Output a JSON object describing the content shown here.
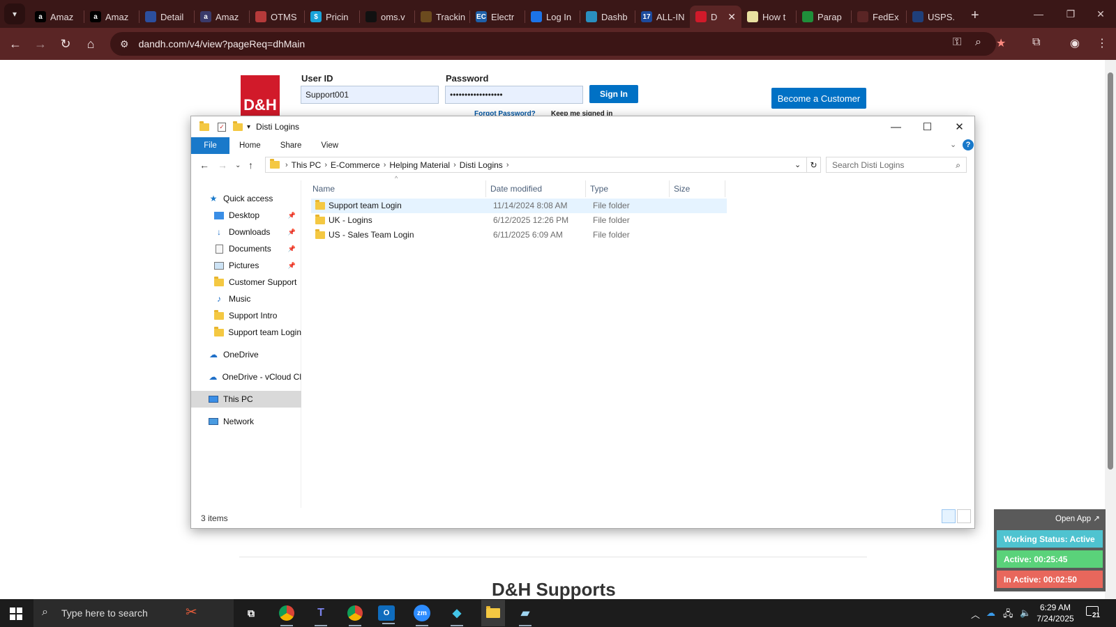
{
  "browser": {
    "tabs": [
      {
        "label": "Amaz",
        "fav": "a",
        "fav_color": "#000000"
      },
      {
        "label": "Amaz",
        "fav": "a",
        "fav_color": "#000000"
      },
      {
        "label": "Detail",
        "fav": "",
        "fav_color": "#2c4f9e"
      },
      {
        "label": "Amaz",
        "fav": "a",
        "fav_color": "#3a3a6a"
      },
      {
        "label": "OTMS",
        "fav": "",
        "fav_color": "#b53a3a"
      },
      {
        "label": "Pricin",
        "fav": "$",
        "fav_color": "#1aa3d9"
      },
      {
        "label": "oms.v",
        "fav": "",
        "fav_color": "#111111"
      },
      {
        "label": "Trackin",
        "fav": "",
        "fav_color": "#6b4a1e"
      },
      {
        "label": "Electr",
        "fav": "EC",
        "fav_color": "#1e5fa8"
      },
      {
        "label": "Log In",
        "fav": "",
        "fav_color": "#1c73e8"
      },
      {
        "label": "Dashb",
        "fav": "",
        "fav_color": "#2a8fbf"
      },
      {
        "label": "ALL-IN",
        "fav": "17",
        "fav_color": "#1d4a9c"
      },
      {
        "label": "D",
        "fav": "",
        "fav_color": "#d11a2a",
        "active": true
      },
      {
        "label": "How t",
        "fav": "",
        "fav_color": "#e8e0a0"
      },
      {
        "label": "Parap",
        "fav": "",
        "fav_color": "#1f8f3a"
      },
      {
        "label": "FedEx",
        "fav": "",
        "fav_color": "#5a2525"
      },
      {
        "label": "USPS.",
        "fav": "",
        "fav_color": "#1f3f7a"
      }
    ],
    "url": "dandh.com/v4/view?pageReq=dhMain"
  },
  "page": {
    "logo_text": "D&H",
    "userid_label": "User ID",
    "userid_value": "Support001",
    "password_label": "Password",
    "password_value": "••••••••••••••••••",
    "signin_label": "Sign In",
    "forgot_label": "Forgot Password?",
    "keep_label": "Keep me signed in",
    "become_label": "Become a Customer",
    "supports_heading": "D&H Supports"
  },
  "explorer": {
    "title": "Disti Logins",
    "ribbon_tabs": [
      "File",
      "Home",
      "Share",
      "View"
    ],
    "breadcrumb": [
      "This PC",
      "E-Commerce",
      "Helping Material",
      "Disti Logins"
    ],
    "search_placeholder": "Search Disti Logins",
    "nav": {
      "quick_access": "Quick access",
      "items": [
        "Desktop",
        "Downloads",
        "Documents",
        "Pictures",
        "Customer Support",
        "Music",
        "Support Intro",
        "Support team Login"
      ],
      "onedrive": "OneDrive",
      "onedrive_vcloud": "OneDrive - vCloud Cl",
      "this_pc": "This PC",
      "network": "Network"
    },
    "columns": [
      "Name",
      "Date modified",
      "Type",
      "Size"
    ],
    "rows": [
      {
        "name": "Support team Login",
        "date": "11/14/2024 8:08 AM",
        "type": "File folder"
      },
      {
        "name": "UK - Logins",
        "date": "6/12/2025 12:26 PM",
        "type": "File folder"
      },
      {
        "name": "US - Sales Team Login",
        "date": "6/11/2025 6:09 AM",
        "type": "File folder"
      }
    ],
    "status": "3 items"
  },
  "widget": {
    "open_app": "Open App ↗",
    "working": "Working Status: Active",
    "active": "Active: 00:25:45",
    "inactive": "In Active: 00:02:50",
    "colors": {
      "working": "#4fc3d0",
      "active": "#5ad27a",
      "inactive": "#e8675c"
    }
  },
  "taskbar": {
    "search_placeholder": "Type here to search",
    "time": "6:29 AM",
    "date": "7/24/2025",
    "notification_count": "21"
  }
}
